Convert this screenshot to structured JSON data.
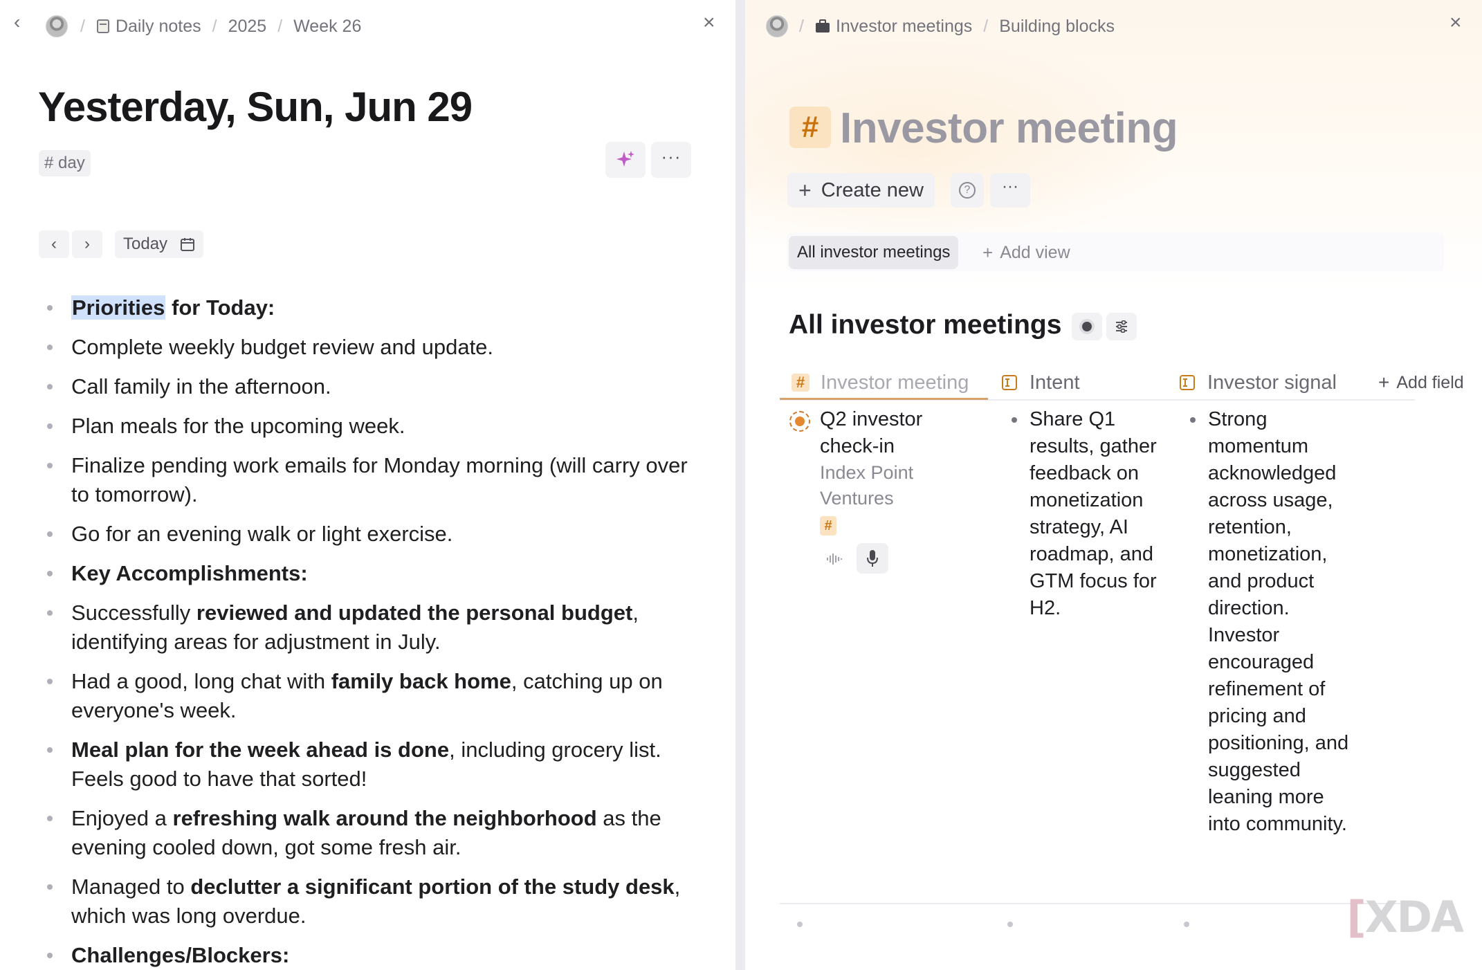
{
  "left_pane": {
    "breadcrumb": [
      "Daily notes",
      "2025",
      "Week 26"
    ],
    "title": "Yesterday, Sun, Jun 29",
    "tag": "# day",
    "date_nav": {
      "today_label": "Today"
    },
    "notes": {
      "priorities_highlight": "Priorities",
      "priorities_rest": " for Today:",
      "item_budget": "Complete weekly budget review and update.",
      "item_call": "Call family in the afternoon.",
      "item_meals": "Plan meals for the upcoming week.",
      "item_emails": "Finalize pending work emails for Monday morning (will carry over to tomorrow).",
      "item_walk": "Go for an evening walk or light exercise.",
      "accomplishments_heading": "Key Accomplishments:",
      "acc1_pre": "Successfully ",
      "acc1_bold": "reviewed and updated the personal budget",
      "acc1_post": ", identifying areas for adjustment in July.",
      "acc2_pre": "Had a good, long chat with ",
      "acc2_bold": "family back home",
      "acc2_post": ", catching up on everyone's week.",
      "acc3_bold": "Meal plan for the week ahead is done",
      "acc3_post": ", including grocery list. Feels good to have that sorted!",
      "acc4_pre": "Enjoyed a ",
      "acc4_bold": "refreshing walk around the neighborhood",
      "acc4_post": " as the evening cooled down, got some fresh air.",
      "acc5_pre": "Managed to ",
      "acc5_bold": "declutter a significant portion of the study desk",
      "acc5_post": ", which was long overdue.",
      "challenges_heading": "Challenges/Blockers:"
    }
  },
  "right_pane": {
    "breadcrumb": [
      "Investor meetings",
      "Building blocks"
    ],
    "db_icon": "#",
    "title": "Investor meeting",
    "create_new_label": "Create new",
    "help_icon": "?",
    "views": {
      "active": "All investor meetings",
      "add_view_label": "Add view"
    },
    "section_title": "All investor meetings",
    "columns": {
      "name": "Investor meeting",
      "intent": "Intent",
      "signal": "Investor signal",
      "add_field": "Add field"
    },
    "row": {
      "title": "Q2 investor check-in",
      "subtitle": "Index Point Ventures",
      "tag": "#",
      "intent": "Share Q1 results, gather feedback on monetization strategy, AI roadmap, and GTM focus for H2.",
      "signal": "Strong momentum acknowledged across usage, retention, monetization, and product direction. Investor encouraged refinement of pricing and positioning, and suggested leaning more into community."
    }
  },
  "watermark": {
    "text": "XDA"
  },
  "colors": {
    "accent_orange": "#c97a1a",
    "highlight_blue": "#cfe1fb",
    "sparkle_purple": "#c05bc6"
  },
  "icons": [
    "back-chevron-icon",
    "avatar",
    "notebook-icon",
    "briefcase-icon",
    "close-icon",
    "sparkle-icon",
    "more-icon",
    "chevron-left-icon",
    "chevron-right-icon",
    "calendar-icon",
    "plus-icon",
    "help-icon",
    "filter-toggle-icon",
    "sliders-icon",
    "text-field-icon",
    "status-circle-icon",
    "waveform-icon",
    "microphone-icon"
  ]
}
